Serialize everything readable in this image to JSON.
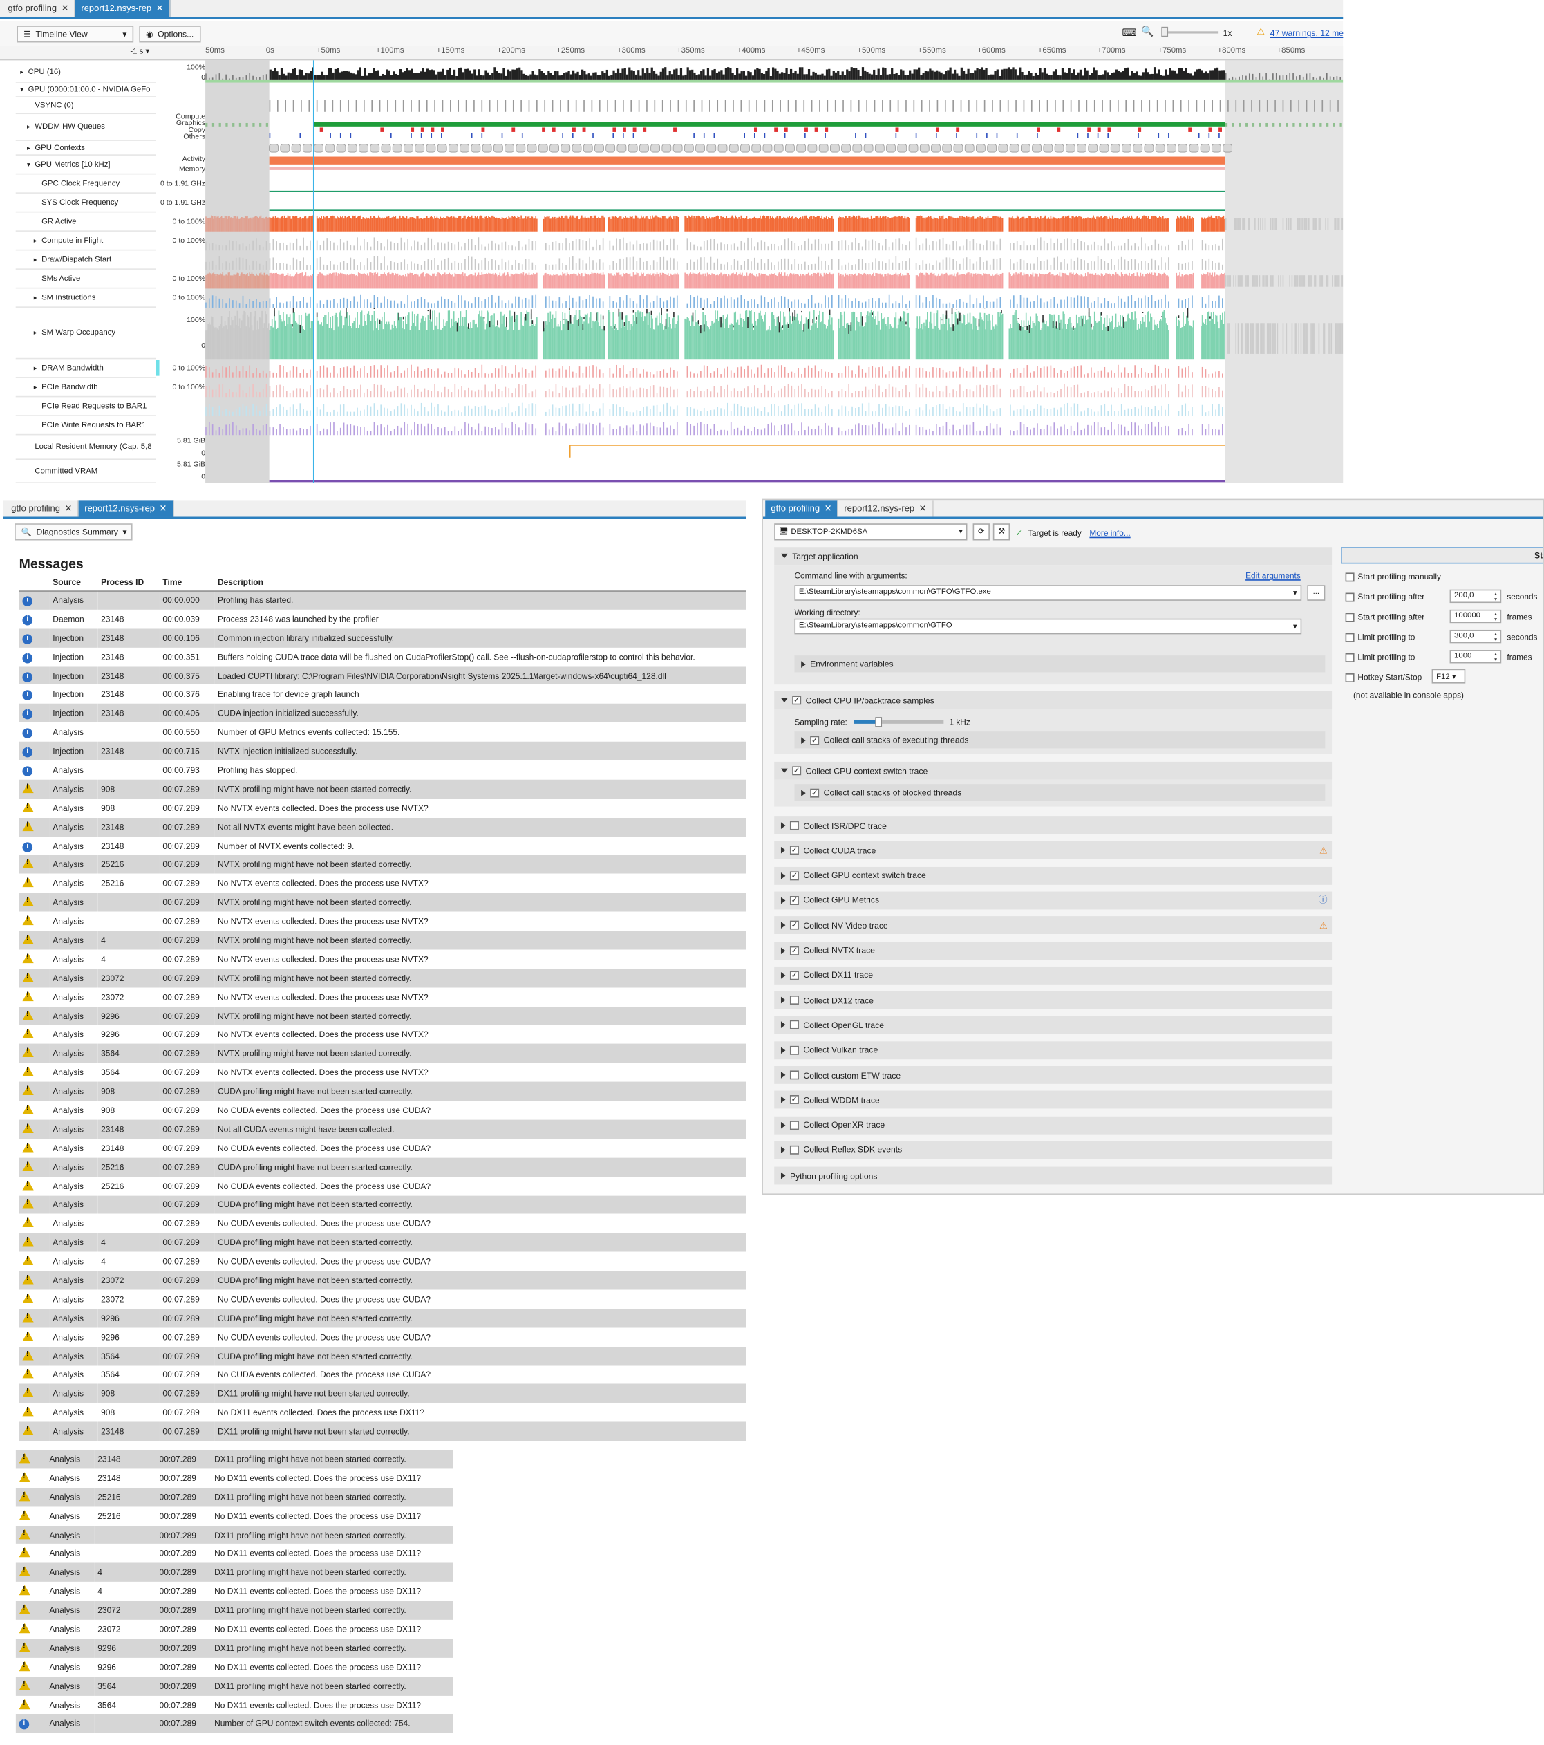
{
  "timeline": {
    "tabs": [
      {
        "label": "gtfo profiling",
        "active": false
      },
      {
        "label": "report12.nsys-rep",
        "active": true
      }
    ],
    "view_label": "Timeline View",
    "options_label": "Options...",
    "zoom_label": "1x",
    "warnings_link": "47 warnings, 12 me",
    "range_label": "-1 s",
    "ticks": [
      "50ms",
      "0s",
      "+50ms",
      "+100ms",
      "+150ms",
      "+200ms",
      "+250ms",
      "+300ms",
      "+350ms",
      "+400ms",
      "+450ms",
      "+500ms",
      "+550ms",
      "+600ms",
      "+650ms",
      "+700ms",
      "+750ms",
      "+800ms",
      "+850ms"
    ],
    "rows": [
      {
        "label": "CPU (16)",
        "expander": "right",
        "indent": 0,
        "scale": [
          "100%",
          "0"
        ]
      },
      {
        "label": "GPU (0000:01:00.0 - NVIDIA GeFo",
        "expander": "down",
        "indent": 0,
        "scale": []
      },
      {
        "label": "VSYNC (0)",
        "expander": "",
        "indent": 1,
        "scale": []
      },
      {
        "label": "WDDM HW Queues",
        "expander": "right",
        "indent": 1,
        "scale": [
          "Compute",
          "Graphics",
          "Copy",
          "Others"
        ]
      },
      {
        "label": "GPU Contexts",
        "expander": "right",
        "indent": 1,
        "scale": []
      },
      {
        "label": "GPU Metrics [10 kHz]",
        "expander": "down",
        "indent": 1,
        "scale": [
          "Activity",
          "Memory"
        ]
      },
      {
        "label": "GPC Clock Frequency",
        "expander": "",
        "indent": 2,
        "scale": [
          "0 to 1.91 GHz"
        ]
      },
      {
        "label": "SYS Clock Frequency",
        "expander": "",
        "indent": 2,
        "scale": [
          "0 to 1.91 GHz"
        ]
      },
      {
        "label": "GR Active",
        "expander": "",
        "indent": 2,
        "scale": [
          "0 to 100%"
        ]
      },
      {
        "label": "Compute in Flight",
        "expander": "right",
        "indent": 2,
        "scale": [
          "0 to 100%"
        ]
      },
      {
        "label": "Draw/Dispatch Start",
        "expander": "right",
        "indent": 2,
        "scale": []
      },
      {
        "label": "SMs Active",
        "expander": "",
        "indent": 2,
        "scale": [
          "0 to 100%"
        ]
      },
      {
        "label": "SM Instructions",
        "expander": "right",
        "indent": 2,
        "scale": [
          "0 to 100%"
        ]
      },
      {
        "label": "SM Warp Occupancy",
        "expander": "right",
        "indent": 2,
        "scale": [
          "100%",
          "0"
        ]
      },
      {
        "label": "DRAM Bandwidth",
        "expander": "right",
        "indent": 2,
        "scale": [
          "0 to 100%"
        ]
      },
      {
        "label": "PCIe Bandwidth",
        "expander": "right",
        "indent": 2,
        "scale": [
          "0 to 100%"
        ]
      },
      {
        "label": "PCIe Read Requests to BAR1",
        "expander": "",
        "indent": 2,
        "scale": []
      },
      {
        "label": "PCIe Write Requests to BAR1",
        "expander": "",
        "indent": 2,
        "scale": []
      },
      {
        "label": "Local Resident Memory (Cap. 5,8",
        "expander": "",
        "indent": 1,
        "scale": [
          "5.81 GiB",
          "0"
        ]
      },
      {
        "label": "Committed VRAM",
        "expander": "",
        "indent": 1,
        "scale": [
          "5.81 GiB",
          "0"
        ]
      }
    ],
    "colors": {
      "orange": "#f26b38",
      "green": "#1f9d3a",
      "pink": "#f5a3a3",
      "teal": "#7fd3b0",
      "blue": "#7fb2e0",
      "cursor": "#3ab3e8"
    }
  },
  "diagnostics": {
    "tabs": [
      {
        "label": "gtfo profiling",
        "active": false
      },
      {
        "label": "report12.nsys-rep",
        "active": true
      }
    ],
    "view_label": "Diagnostics Summary",
    "title": "Messages",
    "headers": [
      "Source",
      "Process ID",
      "Time",
      "Description"
    ],
    "messages": [
      {
        "icon": "info",
        "source": "Analysis",
        "pid": "",
        "time": "00:00.000",
        "desc": "Profiling has started."
      },
      {
        "icon": "info",
        "source": "Daemon",
        "pid": "23148",
        "time": "00:00.039",
        "desc": "Process 23148 was launched by the profiler"
      },
      {
        "icon": "info",
        "source": "Injection",
        "pid": "23148",
        "time": "00:00.106",
        "desc": "Common injection library initialized successfully."
      },
      {
        "icon": "info",
        "source": "Injection",
        "pid": "23148",
        "time": "00:00.351",
        "desc": "Buffers holding CUDA trace data will be flushed on CudaProfilerStop() call. See --flush-on-cudaprofilerstop to control this behavior."
      },
      {
        "icon": "info",
        "source": "Injection",
        "pid": "23148",
        "time": "00:00.375",
        "desc": "Loaded CUPTI library: C:\\Program Files\\NVIDIA Corporation\\Nsight Systems 2025.1.1\\target-windows-x64\\cupti64_128.dll"
      },
      {
        "icon": "info",
        "source": "Injection",
        "pid": "23148",
        "time": "00:00.376",
        "desc": "Enabling trace for device graph launch"
      },
      {
        "icon": "info",
        "source": "Injection",
        "pid": "23148",
        "time": "00:00.406",
        "desc": "CUDA injection initialized successfully."
      },
      {
        "icon": "info",
        "source": "Analysis",
        "pid": "",
        "time": "00:00.550",
        "desc": "Number of GPU Metrics events collected: 15.155."
      },
      {
        "icon": "info",
        "source": "Injection",
        "pid": "23148",
        "time": "00:00.715",
        "desc": "NVTX injection initialized successfully."
      },
      {
        "icon": "info",
        "source": "Analysis",
        "pid": "",
        "time": "00:00.793",
        "desc": "Profiling has stopped."
      },
      {
        "icon": "warn",
        "source": "Analysis",
        "pid": "908",
        "time": "00:07.289",
        "desc": "NVTX profiling might have not been started correctly."
      },
      {
        "icon": "warn",
        "source": "Analysis",
        "pid": "908",
        "time": "00:07.289",
        "desc": "No NVTX events collected. Does the process use NVTX?"
      },
      {
        "icon": "warn",
        "source": "Analysis",
        "pid": "23148",
        "time": "00:07.289",
        "desc": "Not all NVTX events might have been collected."
      },
      {
        "icon": "info",
        "source": "Analysis",
        "pid": "23148",
        "time": "00:07.289",
        "desc": "Number of NVTX events collected: 9."
      },
      {
        "icon": "warn",
        "source": "Analysis",
        "pid": "25216",
        "time": "00:07.289",
        "desc": "NVTX profiling might have not been started correctly."
      },
      {
        "icon": "warn",
        "source": "Analysis",
        "pid": "25216",
        "time": "00:07.289",
        "desc": "No NVTX events collected. Does the process use NVTX?"
      },
      {
        "icon": "warn",
        "source": "Analysis",
        "pid": "",
        "time": "00:07.289",
        "desc": "NVTX profiling might have not been started correctly."
      },
      {
        "icon": "warn",
        "source": "Analysis",
        "pid": "",
        "time": "00:07.289",
        "desc": "No NVTX events collected. Does the process use NVTX?"
      },
      {
        "icon": "warn",
        "source": "Analysis",
        "pid": "4",
        "time": "00:07.289",
        "desc": "NVTX profiling might have not been started correctly."
      },
      {
        "icon": "warn",
        "source": "Analysis",
        "pid": "4",
        "time": "00:07.289",
        "desc": "No NVTX events collected. Does the process use NVTX?"
      },
      {
        "icon": "warn",
        "source": "Analysis",
        "pid": "23072",
        "time": "00:07.289",
        "desc": "NVTX profiling might have not been started correctly."
      },
      {
        "icon": "warn",
        "source": "Analysis",
        "pid": "23072",
        "time": "00:07.289",
        "desc": "No NVTX events collected. Does the process use NVTX?"
      },
      {
        "icon": "warn",
        "source": "Analysis",
        "pid": "9296",
        "time": "00:07.289",
        "desc": "NVTX profiling might have not been started correctly."
      },
      {
        "icon": "warn",
        "source": "Analysis",
        "pid": "9296",
        "time": "00:07.289",
        "desc": "No NVTX events collected. Does the process use NVTX?"
      },
      {
        "icon": "warn",
        "source": "Analysis",
        "pid": "3564",
        "time": "00:07.289",
        "desc": "NVTX profiling might have not been started correctly."
      },
      {
        "icon": "warn",
        "source": "Analysis",
        "pid": "3564",
        "time": "00:07.289",
        "desc": "No NVTX events collected. Does the process use NVTX?"
      },
      {
        "icon": "warn",
        "source": "Analysis",
        "pid": "908",
        "time": "00:07.289",
        "desc": "CUDA profiling might have not been started correctly."
      },
      {
        "icon": "warn",
        "source": "Analysis",
        "pid": "908",
        "time": "00:07.289",
        "desc": "No CUDA events collected. Does the process use CUDA?"
      },
      {
        "icon": "warn",
        "source": "Analysis",
        "pid": "23148",
        "time": "00:07.289",
        "desc": "Not all CUDA events might have been collected."
      },
      {
        "icon": "warn",
        "source": "Analysis",
        "pid": "23148",
        "time": "00:07.289",
        "desc": "No CUDA events collected. Does the process use CUDA?"
      },
      {
        "icon": "warn",
        "source": "Analysis",
        "pid": "25216",
        "time": "00:07.289",
        "desc": "CUDA profiling might have not been started correctly."
      },
      {
        "icon": "warn",
        "source": "Analysis",
        "pid": "25216",
        "time": "00:07.289",
        "desc": "No CUDA events collected. Does the process use CUDA?"
      },
      {
        "icon": "warn",
        "source": "Analysis",
        "pid": "",
        "time": "00:07.289",
        "desc": "CUDA profiling might have not been started correctly."
      },
      {
        "icon": "warn",
        "source": "Analysis",
        "pid": "",
        "time": "00:07.289",
        "desc": "No CUDA events collected. Does the process use CUDA?"
      },
      {
        "icon": "warn",
        "source": "Analysis",
        "pid": "4",
        "time": "00:07.289",
        "desc": "CUDA profiling might have not been started correctly."
      },
      {
        "icon": "warn",
        "source": "Analysis",
        "pid": "4",
        "time": "00:07.289",
        "desc": "No CUDA events collected. Does the process use CUDA?"
      },
      {
        "icon": "warn",
        "source": "Analysis",
        "pid": "23072",
        "time": "00:07.289",
        "desc": "CUDA profiling might have not been started correctly."
      },
      {
        "icon": "warn",
        "source": "Analysis",
        "pid": "23072",
        "time": "00:07.289",
        "desc": "No CUDA events collected. Does the process use CUDA?"
      },
      {
        "icon": "warn",
        "source": "Analysis",
        "pid": "9296",
        "time": "00:07.289",
        "desc": "CUDA profiling might have not been started correctly."
      },
      {
        "icon": "warn",
        "source": "Analysis",
        "pid": "9296",
        "time": "00:07.289",
        "desc": "No CUDA events collected. Does the process use CUDA?"
      },
      {
        "icon": "warn",
        "source": "Analysis",
        "pid": "3564",
        "time": "00:07.289",
        "desc": "CUDA profiling might have not been started correctly."
      },
      {
        "icon": "warn",
        "source": "Analysis",
        "pid": "3564",
        "time": "00:07.289",
        "desc": "No CUDA events collected. Does the process use CUDA?"
      },
      {
        "icon": "warn",
        "source": "Analysis",
        "pid": "908",
        "time": "00:07.289",
        "desc": "DX11 profiling might have not been started correctly."
      },
      {
        "icon": "warn",
        "source": "Analysis",
        "pid": "908",
        "time": "00:07.289",
        "desc": "No DX11 events collected. Does the process use DX11?"
      },
      {
        "icon": "warn",
        "source": "Analysis",
        "pid": "23148",
        "time": "00:07.289",
        "desc": "DX11 profiling might have not been started correctly."
      }
    ],
    "messages_continued": [
      {
        "icon": "warn",
        "source": "Analysis",
        "pid": "23148",
        "time": "00:07.289",
        "desc": "DX11 profiling might have not been started correctly."
      },
      {
        "icon": "warn",
        "source": "Analysis",
        "pid": "23148",
        "time": "00:07.289",
        "desc": "No DX11 events collected. Does the process use DX11?"
      },
      {
        "icon": "warn",
        "source": "Analysis",
        "pid": "25216",
        "time": "00:07.289",
        "desc": "DX11 profiling might have not been started correctly."
      },
      {
        "icon": "warn",
        "source": "Analysis",
        "pid": "25216",
        "time": "00:07.289",
        "desc": "No DX11 events collected. Does the process use DX11?"
      },
      {
        "icon": "warn",
        "source": "Analysis",
        "pid": "",
        "time": "00:07.289",
        "desc": "DX11 profiling might have not been started correctly."
      },
      {
        "icon": "warn",
        "source": "Analysis",
        "pid": "",
        "time": "00:07.289",
        "desc": "No DX11 events collected. Does the process use DX11?"
      },
      {
        "icon": "warn",
        "source": "Analysis",
        "pid": "4",
        "time": "00:07.289",
        "desc": "DX11 profiling might have not been started correctly."
      },
      {
        "icon": "warn",
        "source": "Analysis",
        "pid": "4",
        "time": "00:07.289",
        "desc": "No DX11 events collected. Does the process use DX11?"
      },
      {
        "icon": "warn",
        "source": "Analysis",
        "pid": "23072",
        "time": "00:07.289",
        "desc": "DX11 profiling might have not been started correctly."
      },
      {
        "icon": "warn",
        "source": "Analysis",
        "pid": "23072",
        "time": "00:07.289",
        "desc": "No DX11 events collected. Does the process use DX11?"
      },
      {
        "icon": "warn",
        "source": "Analysis",
        "pid": "9296",
        "time": "00:07.289",
        "desc": "DX11 profiling might have not been started correctly."
      },
      {
        "icon": "warn",
        "source": "Analysis",
        "pid": "9296",
        "time": "00:07.289",
        "desc": "No DX11 events collected. Does the process use DX11?"
      },
      {
        "icon": "warn",
        "source": "Analysis",
        "pid": "3564",
        "time": "00:07.289",
        "desc": "DX11 profiling might have not been started correctly."
      },
      {
        "icon": "warn",
        "source": "Analysis",
        "pid": "3564",
        "time": "00:07.289",
        "desc": "No DX11 events collected. Does the process use DX11?"
      },
      {
        "icon": "info",
        "source": "Analysis",
        "pid": "",
        "time": "00:07.289",
        "desc": "Number of GPU context switch events collected: 754."
      }
    ]
  },
  "settings": {
    "tabs": [
      {
        "label": "gtfo profiling",
        "active": true
      },
      {
        "label": "report12.nsys-rep",
        "active": false
      }
    ],
    "target_host": "DESKTOP-2KMD6SA",
    "target_status": "Target is ready",
    "more_info": "More info...",
    "target_app_label": "Target application",
    "cmdline_label": "Command line with arguments:",
    "edit_args": "Edit arguments",
    "cmdline_value": "E:\\SteamLibrary\\steamapps\\common\\GTFO\\GTFO.exe",
    "browse_label": "...",
    "workdir_label": "Working directory:",
    "workdir_value": "E:\\SteamLibrary\\steamapps\\common\\GTFO",
    "env_vars": "Environment variables",
    "cpu_ip": "Collect CPU IP/backtrace samples",
    "sampling_rate_label": "Sampling rate:",
    "sampling_rate_value": "1 kHz",
    "sampling_rate_fraction": 0.28,
    "call_stacks_exec": "Collect call stacks of executing threads",
    "cpu_ctx": "Collect CPU context switch trace",
    "call_stacks_blocked": "Collect call stacks of blocked threads",
    "options": [
      {
        "label": "Collect ISR/DPC trace",
        "checked": false,
        "badge": ""
      },
      {
        "label": "Collect CUDA trace",
        "checked": true,
        "badge": "warn"
      },
      {
        "label": "Collect GPU context switch trace",
        "checked": true,
        "badge": ""
      },
      {
        "label": "Collect GPU Metrics",
        "checked": true,
        "badge": "info"
      },
      {
        "label": "Collect NV Video trace",
        "checked": true,
        "badge": "warn"
      },
      {
        "label": "Collect NVTX trace",
        "checked": true,
        "badge": ""
      },
      {
        "label": "Collect DX11 trace",
        "checked": true,
        "badge": ""
      },
      {
        "label": "Collect DX12 trace",
        "checked": false,
        "badge": ""
      },
      {
        "label": "Collect OpenGL trace",
        "checked": false,
        "badge": ""
      },
      {
        "label": "Collect Vulkan trace",
        "checked": false,
        "badge": ""
      },
      {
        "label": "Collect custom ETW trace",
        "checked": false,
        "badge": ""
      },
      {
        "label": "Collect WDDM trace",
        "checked": true,
        "badge": ""
      },
      {
        "label": "Collect OpenXR trace",
        "checked": false,
        "badge": ""
      },
      {
        "label": "Collect Reflex SDK events",
        "checked": false,
        "badge": ""
      }
    ],
    "python_opts": "Python profiling options",
    "start_button": "Star",
    "right": {
      "manual": "Start profiling manually",
      "after_seconds_label": "Start profiling after",
      "after_seconds_value": "200,0",
      "after_seconds_unit": "seconds",
      "after_frames_label": "Start profiling after",
      "after_frames_value": "100000",
      "after_frames_unit": "frames",
      "limit_seconds_label": "Limit profiling to",
      "limit_seconds_value": "300,0",
      "limit_seconds_unit": "seconds",
      "limit_frames_label": "Limit profiling to",
      "limit_frames_value": "1000",
      "limit_frames_unit": "frames",
      "hotkey_label": "Hotkey Start/Stop",
      "hotkey_value": "F12",
      "note": "(not available in console apps)"
    }
  }
}
